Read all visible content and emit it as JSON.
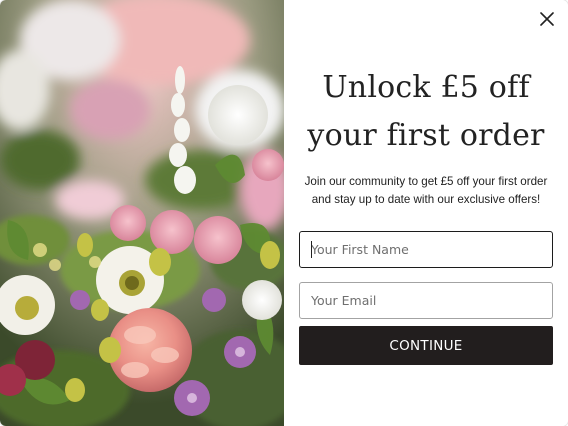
{
  "popup": {
    "headline_line1": "Unlock £5 off",
    "headline_line2": "your first order",
    "subtext": "Join our community to get £5 off your first order and stay up to date with our exclusive offers!",
    "first_name_placeholder": "Your First Name",
    "email_placeholder": "Your Email",
    "continue_label": "CONTINUE",
    "close_icon": "close-icon"
  },
  "image": {
    "subject": "flower-bouquet-photo"
  },
  "colors": {
    "button_bg": "#221e1e",
    "text": "#222222",
    "field_border": "#a3a3a3"
  }
}
